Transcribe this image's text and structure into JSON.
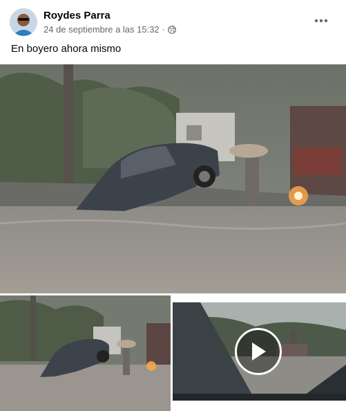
{
  "post": {
    "author_name": "Roydes Parra",
    "timestamp": "24 de septiembre a las 15:32",
    "separator": "·",
    "privacy_icon": "globe-icon",
    "more_icon": "more-horizontal-icon",
    "text": "En boyero ahora mismo"
  },
  "media": {
    "items": [
      {
        "type": "photo",
        "name": "flooded-street-car-photo"
      },
      {
        "type": "photo",
        "name": "flooded-street-car-photo-small"
      },
      {
        "type": "video",
        "name": "windshield-rain-video",
        "overlay_icon": "play-icon"
      }
    ]
  },
  "colors": {
    "name": "#050505",
    "meta": "#65676b",
    "background": "#ffffff"
  }
}
